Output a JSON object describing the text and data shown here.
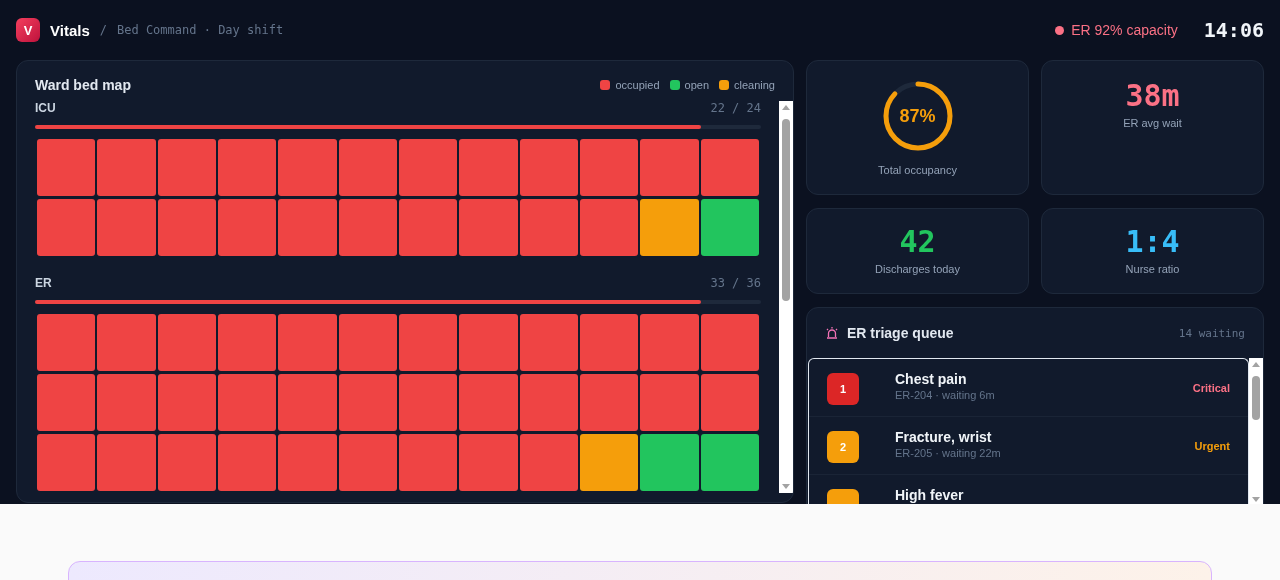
{
  "header": {
    "logo": "V",
    "app": "Vitals",
    "separator": "/",
    "context": "Bed Command · Day shift",
    "alert": {
      "text": "ER 92% capacity",
      "color": "#fb7185"
    },
    "time": "14:06"
  },
  "bed_map": {
    "title": "Ward bed map",
    "legend": [
      {
        "label": "occupied",
        "color": "#ef4444"
      },
      {
        "label": "open",
        "color": "#22c55e"
      },
      {
        "label": "cleaning",
        "color": "#f59e0b"
      }
    ],
    "wards": [
      {
        "name": "ICU",
        "count": "22 / 24",
        "level": 0.917,
        "beds": [
          {
            "color": "#ef4444"
          },
          {
            "color": "#ef4444"
          },
          {
            "color": "#ef4444"
          },
          {
            "color": "#ef4444"
          },
          {
            "color": "#ef4444"
          },
          {
            "color": "#ef4444"
          },
          {
            "color": "#ef4444"
          },
          {
            "color": "#ef4444"
          },
          {
            "color": "#ef4444"
          },
          {
            "color": "#ef4444"
          },
          {
            "color": "#ef4444"
          },
          {
            "color": "#ef4444"
          },
          {
            "color": "#ef4444"
          },
          {
            "color": "#ef4444"
          },
          {
            "color": "#ef4444"
          },
          {
            "color": "#ef4444"
          },
          {
            "color": "#ef4444"
          },
          {
            "color": "#ef4444"
          },
          {
            "color": "#ef4444"
          },
          {
            "color": "#ef4444"
          },
          {
            "color": "#ef4444"
          },
          {
            "color": "#ef4444"
          },
          {
            "color": "#f59e0b"
          },
          {
            "color": "#22c55e"
          }
        ]
      },
      {
        "name": "ER",
        "count": "33 / 36",
        "level": 0.917,
        "beds": [
          {
            "color": "#ef4444"
          },
          {
            "color": "#ef4444"
          },
          {
            "color": "#ef4444"
          },
          {
            "color": "#ef4444"
          },
          {
            "color": "#ef4444"
          },
          {
            "color": "#ef4444"
          },
          {
            "color": "#ef4444"
          },
          {
            "color": "#ef4444"
          },
          {
            "color": "#ef4444"
          },
          {
            "color": "#ef4444"
          },
          {
            "color": "#ef4444"
          },
          {
            "color": "#ef4444"
          },
          {
            "color": "#ef4444"
          },
          {
            "color": "#ef4444"
          },
          {
            "color": "#ef4444"
          },
          {
            "color": "#ef4444"
          },
          {
            "color": "#ef4444"
          },
          {
            "color": "#ef4444"
          },
          {
            "color": "#ef4444"
          },
          {
            "color": "#ef4444"
          },
          {
            "color": "#ef4444"
          },
          {
            "color": "#ef4444"
          },
          {
            "color": "#ef4444"
          },
          {
            "color": "#ef4444"
          },
          {
            "color": "#ef4444"
          },
          {
            "color": "#ef4444"
          },
          {
            "color": "#ef4444"
          },
          {
            "color": "#ef4444"
          },
          {
            "color": "#ef4444"
          },
          {
            "color": "#ef4444"
          },
          {
            "color": "#ef4444"
          },
          {
            "color": "#ef4444"
          },
          {
            "color": "#ef4444"
          },
          {
            "color": "#f59e0b"
          },
          {
            "color": "#22c55e"
          },
          {
            "color": "#22c55e"
          }
        ]
      }
    ]
  },
  "occupancy": {
    "value": "87%",
    "label": "Total occupancy"
  },
  "stats": [
    {
      "value": "38m",
      "label": "ER avg wait",
      "color": "#fb7185"
    },
    {
      "value": "42",
      "label": "Discharges today",
      "color": "#22c55e"
    },
    {
      "value": "1:4",
      "label": "Nurse ratio",
      "color": "#38bdf8"
    }
  ],
  "triage": {
    "title": "ER triage queue",
    "count": "14 waiting",
    "rows": [
      {
        "level": "1",
        "complaint": "Chest pain",
        "detail": "ER-204 · waiting 6m",
        "priority": "Critical",
        "color": "#dc2626"
      },
      {
        "level": "2",
        "complaint": "Fracture, wrist",
        "detail": "ER-205 · waiting 22m",
        "priority": "Urgent",
        "color": "#f59e0b"
      },
      {
        "complaint": "High fever",
        "color": "#f59e0b"
      }
    ]
  }
}
